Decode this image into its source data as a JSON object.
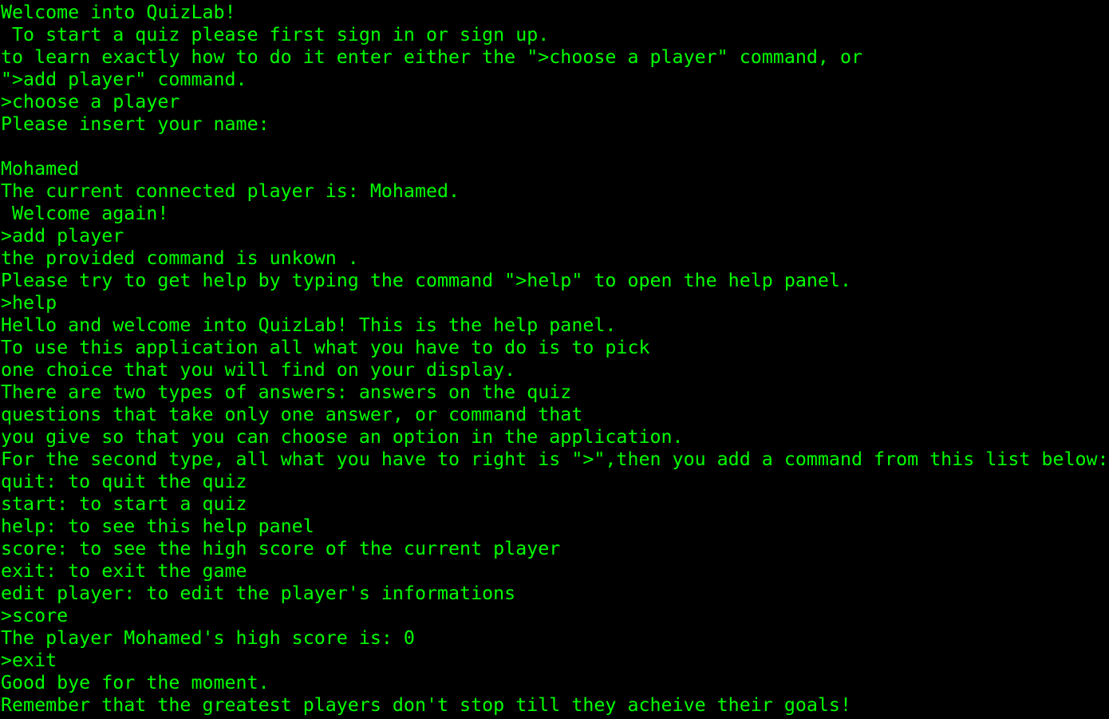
{
  "colors": {
    "background": "#000000",
    "text": "#00ff00"
  },
  "terminal": {
    "lines": [
      "Welcome into QuizLab!",
      " To start a quiz please first sign in or sign up.",
      "to learn exactly how to do it enter either the \">choose a player\" command, or",
      "\">add player\" command.",
      ">choose a player",
      "Please insert your name:",
      "",
      "Mohamed",
      "The current connected player is: Mohamed.",
      " Welcome again!",
      ">add player",
      "the provided command is unkown .",
      "Please try to get help by typing the command \">help\" to open the help panel.",
      ">help",
      "Hello and welcome into QuizLab! This is the help panel.",
      "To use this application all what you have to do is to pick",
      "one choice that you will find on your display.",
      "There are two types of answers: answers on the quiz",
      "questions that take only one answer, or command that",
      "you give so that you can choose an option in the application.",
      "For the second type, all what you have to right is \">\",then you add a command from this list below:",
      "quit: to quit the quiz",
      "start: to start a quiz",
      "help: to see this help panel",
      "score: to see the high score of the current player",
      "exit: to exit the game",
      "edit player: to edit the player's informations",
      ">score",
      "The player Mohamed's high score is: 0",
      ">exit",
      "Good bye for the moment.",
      "Remember that the greatest players don't stop till they acheive their goals!"
    ]
  }
}
